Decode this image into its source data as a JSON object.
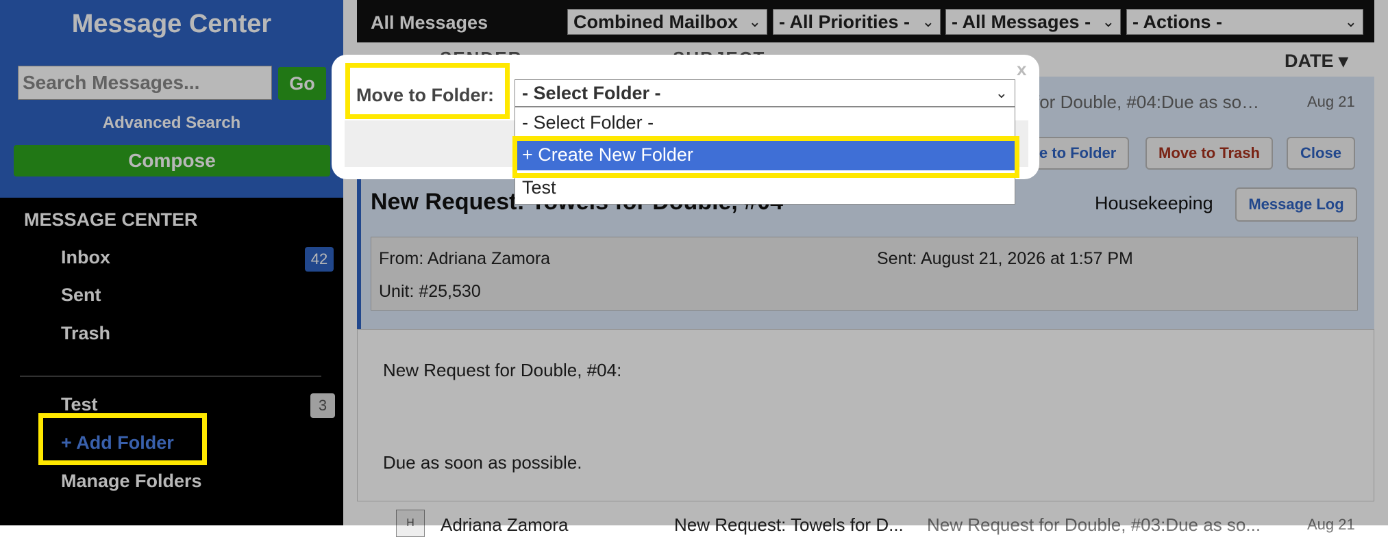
{
  "sidebar": {
    "title": "Message Center",
    "search_placeholder": "Search Messages...",
    "go_label": "Go",
    "advanced_search": "Advanced Search",
    "compose": "Compose",
    "section_title": "MESSAGE CENTER",
    "items": [
      {
        "label": "Inbox",
        "count": "42"
      },
      {
        "label": "Sent"
      },
      {
        "label": "Trash"
      }
    ],
    "folders": [
      {
        "label": "Test",
        "count": "3"
      }
    ],
    "add_folder": "+ Add Folder",
    "manage_folders": "Manage Folders"
  },
  "topbar": {
    "title": "All Messages",
    "mailbox": "Combined Mailbox",
    "priorities": "- All Priorities -",
    "messages_filter": "- All Messages -",
    "actions": "- Actions -"
  },
  "list_header": {
    "sender": "SENDER",
    "subject": "SUBJECT",
    "date": "DATE ▾"
  },
  "message": {
    "preview": "for Double, #04:Due as so…",
    "date": "Aug 21",
    "move_to_folder": "ve to Folder",
    "move_to_trash": "Move to Trash",
    "close": "Close",
    "title": "New Request: Towels for Double, #04",
    "category": "Housekeeping",
    "message_log": "Message Log",
    "from": "From: Adriana Zamora",
    "sent": "Sent: August 21, 2026 at 1:57 PM",
    "unit": "Unit: #25,530",
    "body_line1": "New Request for Double, #04:",
    "body_line2": "Due as soon as possible."
  },
  "next_row": {
    "avatar": "H",
    "sender": "Adriana Zamora",
    "subject": "New Request: Towels for D...",
    "preview": "New Request for Double, #03:Due as so...",
    "date": "Aug 21"
  },
  "modal": {
    "close": "x",
    "label": "Move to Folder:",
    "selected": "- Select Folder -",
    "options": [
      "- Select Folder -",
      "+ Create New Folder",
      "Test"
    ]
  },
  "colors": {
    "brand_blue": "#2f63c2",
    "compose_green": "#2ea51e",
    "highlight_yellow": "#ffe800",
    "dropdown_selected": "#3f6fd6"
  }
}
